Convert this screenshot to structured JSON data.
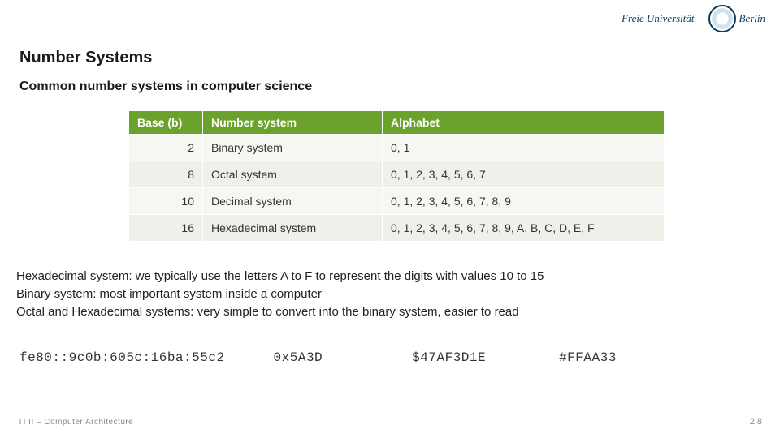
{
  "logo": {
    "left": "Freie Universität",
    "right": "Berlin"
  },
  "title": "Number Systems",
  "subtitle": "Common number systems in computer science",
  "table": {
    "headers": {
      "base": "Base (b)",
      "system": "Number system",
      "alphabet": "Alphabet"
    },
    "rows": [
      {
        "base": "2",
        "system": "Binary system",
        "alphabet": "0, 1"
      },
      {
        "base": "8",
        "system": "Octal system",
        "alphabet": "0, 1, 2, 3, 4, 5, 6, 7"
      },
      {
        "base": "10",
        "system": "Decimal system",
        "alphabet": "0, 1, 2, 3, 4, 5, 6, 7, 8, 9"
      },
      {
        "base": "16",
        "system": "Hexadecimal system",
        "alphabet": "0, 1, 2, 3, 4, 5, 6, 7, 8, 9, A, B, C, D, E, F"
      }
    ]
  },
  "notes": {
    "line1": "Hexadecimal system: we typically use the letters A to F to represent the digits with values 10 to 15",
    "line2": "Binary system: most important system inside a computer",
    "line3": "Octal and Hexadecimal systems: very simple to convert into the binary system, easier to read"
  },
  "examples": {
    "ex0": "fe80::9c0b:605c:16ba:55c2",
    "ex1": "0x5A3D",
    "ex2": "$47AF3D1E",
    "ex3": "#FFAA33"
  },
  "footer": {
    "left": "TI II – Computer Architecture",
    "right": "2.8"
  }
}
